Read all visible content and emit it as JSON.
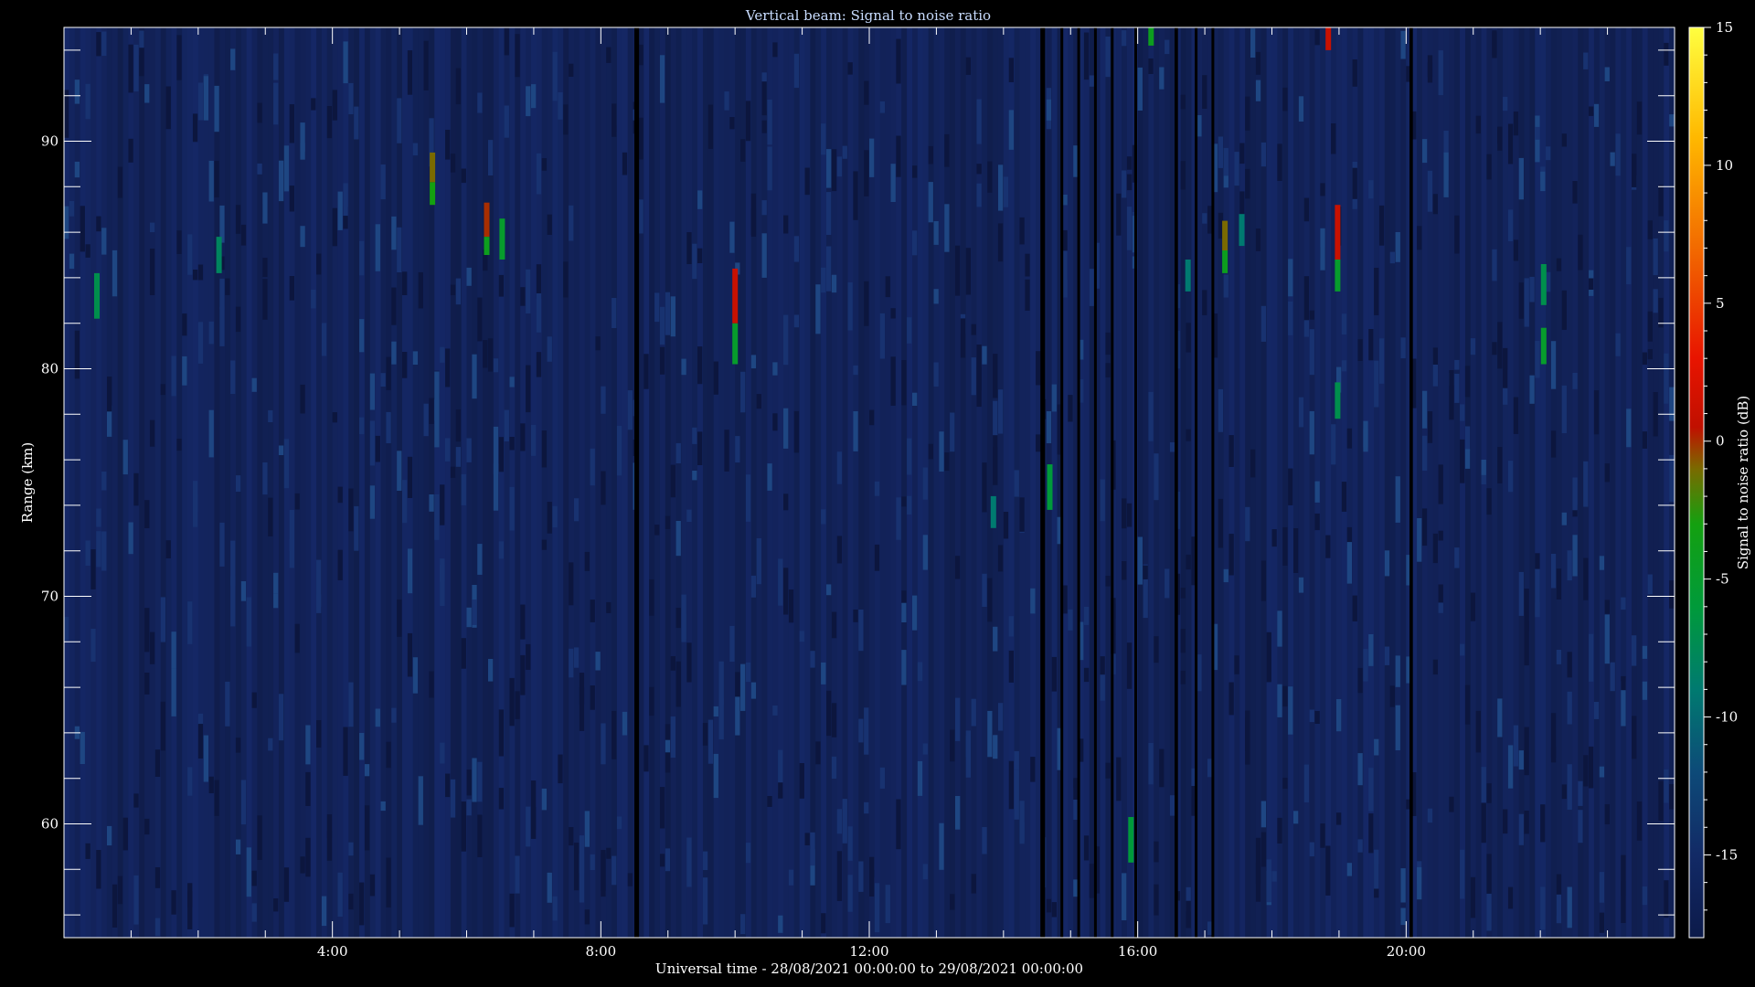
{
  "chart_data": {
    "type": "heatmap",
    "title": "Vertical beam: Signal to noise ratio",
    "xlabel": "Universal time - 28/08/2021 00:00:00 to 29/08/2021 00:00:00",
    "ylabel": "Range (km)",
    "colorbar_label": "Signal to noise ratio (dB)",
    "x_unit": "hours UT",
    "xlim": [
      0,
      24
    ],
    "ylim": [
      55,
      95
    ],
    "zlim": [
      -18,
      15
    ],
    "x_ticks": [
      {
        "value": 4,
        "label": "4:00"
      },
      {
        "value": 8,
        "label": "8:00"
      },
      {
        "value": 12,
        "label": "12:00"
      },
      {
        "value": 16,
        "label": "16:00"
      },
      {
        "value": 20,
        "label": "20:00"
      }
    ],
    "y_ticks": [
      {
        "value": 60,
        "label": "60"
      },
      {
        "value": 70,
        "label": "70"
      },
      {
        "value": 80,
        "label": "80"
      },
      {
        "value": 90,
        "label": "90"
      }
    ],
    "colorbar_ticks": [
      {
        "value": 15,
        "label": "15"
      },
      {
        "value": 10,
        "label": "10"
      },
      {
        "value": 5,
        "label": "5"
      },
      {
        "value": 0,
        "label": "0"
      },
      {
        "value": -5,
        "label": "-5"
      },
      {
        "value": -10,
        "label": "-10"
      },
      {
        "value": -15,
        "label": "-15"
      }
    ],
    "colormap": [
      {
        "v": -18,
        "color": "#0c1a4a"
      },
      {
        "v": -15,
        "color": "#122a66"
      },
      {
        "v": -12,
        "color": "#0d4a78"
      },
      {
        "v": -9,
        "color": "#007a70"
      },
      {
        "v": -6,
        "color": "#009a3a"
      },
      {
        "v": -3,
        "color": "#14a010"
      },
      {
        "v": -1,
        "color": "#7a6a00"
      },
      {
        "v": 0.5,
        "color": "#c01000"
      },
      {
        "v": 3,
        "color": "#e81400"
      },
      {
        "v": 7,
        "color": "#f26a00"
      },
      {
        "v": 11,
        "color": "#ffb800"
      },
      {
        "v": 15,
        "color": "#ffff40"
      }
    ],
    "background_snr": -16,
    "data_gaps": [
      {
        "x0": 8.5,
        "x1": 8.57
      },
      {
        "x0": 14.55,
        "x1": 14.62
      },
      {
        "x0": 14.85,
        "x1": 14.89
      },
      {
        "x0": 15.1,
        "x1": 15.14
      },
      {
        "x0": 15.35,
        "x1": 15.39
      },
      {
        "x0": 15.6,
        "x1": 15.64
      },
      {
        "x0": 15.95,
        "x1": 15.99
      },
      {
        "x0": 16.55,
        "x1": 16.6
      },
      {
        "x0": 16.85,
        "x1": 16.89
      },
      {
        "x0": 17.1,
        "x1": 17.14
      },
      {
        "x0": 20.05,
        "x1": 20.1
      }
    ],
    "echoes": [
      {
        "x": 0.49,
        "y0": 82.2,
        "y1": 84.2,
        "snr": -7
      },
      {
        "x": 2.31,
        "y0": 84.2,
        "y1": 85.8,
        "snr": -8
      },
      {
        "x": 5.49,
        "y0": 87.2,
        "y1": 88.2,
        "snr": -3
      },
      {
        "x": 5.49,
        "y0": 88.2,
        "y1": 89.5,
        "snr": -1
      },
      {
        "x": 6.3,
        "y0": 85.0,
        "y1": 85.8,
        "snr": -4
      },
      {
        "x": 6.3,
        "y0": 85.8,
        "y1": 87.3,
        "snr": 0
      },
      {
        "x": 6.53,
        "y0": 84.8,
        "y1": 86.6,
        "snr": -5
      },
      {
        "x": 10.0,
        "y0": 80.2,
        "y1": 82.0,
        "snr": -5
      },
      {
        "x": 10.0,
        "y0": 82.0,
        "y1": 84.4,
        "snr": 1
      },
      {
        "x": 13.85,
        "y0": 73.0,
        "y1": 74.4,
        "snr": -9
      },
      {
        "x": 14.69,
        "y0": 73.8,
        "y1": 75.8,
        "snr": -6
      },
      {
        "x": 15.9,
        "y0": 58.3,
        "y1": 60.3,
        "snr": -6
      },
      {
        "x": 16.2,
        "y0": 94.2,
        "y1": 95.0,
        "snr": -4
      },
      {
        "x": 16.75,
        "y0": 83.4,
        "y1": 84.8,
        "snr": -9
      },
      {
        "x": 17.3,
        "y0": 84.2,
        "y1": 85.2,
        "snr": -4
      },
      {
        "x": 17.3,
        "y0": 85.2,
        "y1": 86.5,
        "snr": -1
      },
      {
        "x": 17.55,
        "y0": 85.4,
        "y1": 86.8,
        "snr": -9
      },
      {
        "x": 18.84,
        "y0": 94.0,
        "y1": 95.0,
        "snr": 1
      },
      {
        "x": 18.98,
        "y0": 83.4,
        "y1": 84.8,
        "snr": -5
      },
      {
        "x": 18.98,
        "y0": 84.8,
        "y1": 87.2,
        "snr": 1
      },
      {
        "x": 18.98,
        "y0": 77.8,
        "y1": 79.4,
        "snr": -7
      },
      {
        "x": 22.05,
        "y0": 82.8,
        "y1": 84.6,
        "snr": -7
      },
      {
        "x": 22.05,
        "y0": 80.2,
        "y1": 81.8,
        "snr": -5
      }
    ]
  }
}
